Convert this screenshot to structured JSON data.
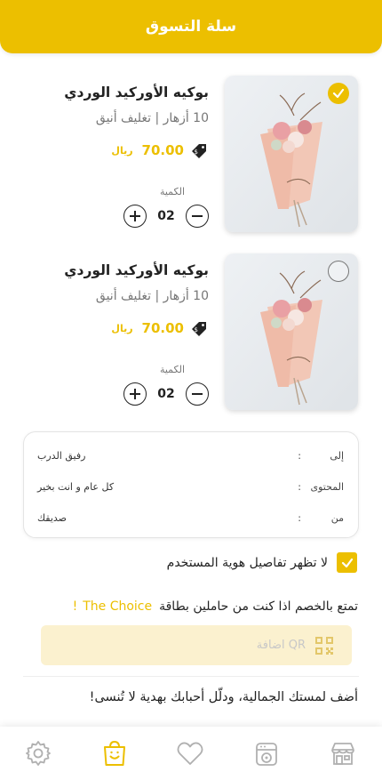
{
  "header": {
    "title": "سلة التسوق"
  },
  "products": [
    {
      "title": "بوكيه الأوركيد الوردي",
      "subtitle": "10 أزهار | تغليف أنيق",
      "price": "70.00",
      "currency": "ريال",
      "quantity_label": "الكمية",
      "quantity": "02",
      "selected": true
    },
    {
      "title": "بوكيه الأوركيد الوردي",
      "subtitle": "10 أزهار | تغليف أنيق",
      "price": "70.00",
      "currency": "ريال",
      "quantity_label": "الكمية",
      "quantity": "02",
      "selected": false
    }
  ],
  "gift_card": {
    "rows": [
      {
        "label": "إلى",
        "colon": ":",
        "value": "رفيق الدرب"
      },
      {
        "label": "المحتوى",
        "colon": ":",
        "value": "كل عام و انت بخير"
      },
      {
        "label": "من",
        "colon": ":",
        "value": "صديقك"
      }
    ]
  },
  "hide_identity": {
    "label": "لا تظهر تفاصيل هوية المستخدم",
    "checked": true
  },
  "promo": {
    "text": "تمتع بالخصم اذا كنت من حاملين بطاقة",
    "brand": "The Choice",
    "exclamation": "!"
  },
  "qr": {
    "placeholder": "اضافة QR"
  },
  "gift_message": "أضف لمستك الجمالية، ودلّل أحبابك بهدية لا تُنسى!",
  "bottom_nav": [
    {
      "name": "settings",
      "icon": "gear-icon",
      "active": false
    },
    {
      "name": "cart",
      "icon": "shopping-bag-icon",
      "active": true
    },
    {
      "name": "favorites",
      "icon": "heart-icon",
      "active": false
    },
    {
      "name": "orders",
      "icon": "orders-icon",
      "active": false
    },
    {
      "name": "store",
      "icon": "store-icon",
      "active": false
    }
  ],
  "colors": {
    "accent": "#ecbf00",
    "accent_light": "#fbf1cf",
    "text": "#222222",
    "muted": "#777777"
  }
}
